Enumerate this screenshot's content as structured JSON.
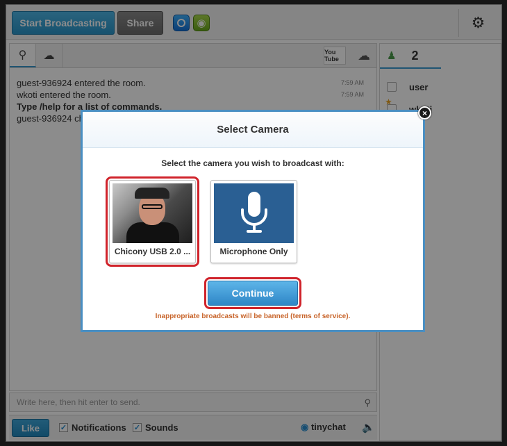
{
  "toolbar": {
    "start_broadcasting": "Start Broadcasting",
    "share": "Share",
    "settings_icon": "gear-icon"
  },
  "chat": {
    "tabs": [
      "search-icon",
      "chat-bubbles-icon",
      "youtube-icon",
      "soundcloud-icon"
    ],
    "youtube_text": "You Tube",
    "messages": [
      {
        "text": "guest-936924 entered the room.",
        "time": "7:59 AM"
      },
      {
        "text": "wkoti entered the room.",
        "time": "7:59 AM"
      },
      {
        "text": "Type /help for a list of commands.",
        "bold": true
      },
      {
        "text": "guest-936924 changed camera."
      }
    ],
    "input_placeholder": "Write here, then hit enter to send."
  },
  "bottombar": {
    "like": "Like",
    "notifications": "Notifications",
    "sounds": "Sounds",
    "brand": "tinychat"
  },
  "users": {
    "count": "2",
    "list": [
      "user",
      "wkoti"
    ]
  },
  "modal": {
    "title": "Select Camera",
    "prompt": "Select the camera you wish to broadcast with:",
    "cameras": [
      {
        "label": "Chicony USB 2.0 ...",
        "selected": true
      },
      {
        "label": "Microphone Only",
        "selected": false
      }
    ],
    "continue": "Continue",
    "warning_prefix": "Inappropriate broadcasts will be banned (",
    "warning_link": "terms of service",
    "warning_suffix": ").",
    "close": "×"
  },
  "colors": {
    "accent": "#2f86c7",
    "highlight": "#d0232b",
    "warning": "#c8642a"
  }
}
